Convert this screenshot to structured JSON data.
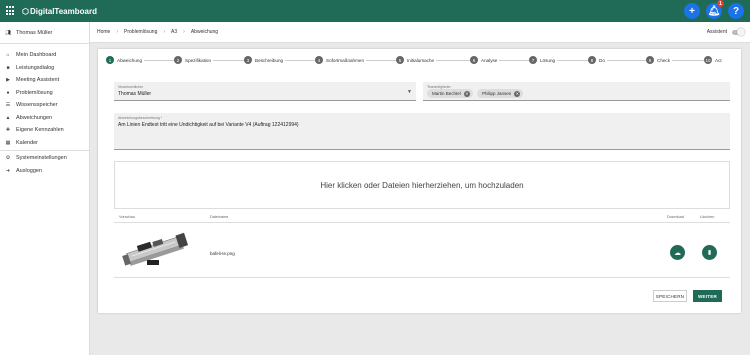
{
  "app": {
    "brand": "DigitalTeamboard",
    "notification_count": "1"
  },
  "header_buttons": {
    "add": "+",
    "help": "?"
  },
  "sidebar": {
    "user": "Thomas Müller",
    "items": [
      {
        "label": "Mein Dashboard",
        "icon": "home-icon"
      },
      {
        "label": "Leistungsdialog",
        "icon": "briefcase-icon"
      },
      {
        "label": "Meeting Assistent",
        "icon": "camera-icon"
      },
      {
        "label": "Problemlösung",
        "icon": "lightbulb-icon"
      },
      {
        "label": "Wissensspeicher",
        "icon": "list-icon"
      },
      {
        "label": "Abweichungen",
        "icon": "warning-icon"
      },
      {
        "label": "Eigene Kennzahlen",
        "icon": "user-plus-icon"
      },
      {
        "label": "Kalender",
        "icon": "calendar-icon"
      },
      {
        "label": "Systemeinstellungen",
        "icon": "users-cog-icon"
      },
      {
        "label": "Ausloggen",
        "icon": "logout-icon"
      }
    ]
  },
  "breadcrumb": [
    "Home",
    "Problemlösung",
    "A3",
    "Abweichung"
  ],
  "assistant_label": "Assistent",
  "steps": [
    {
      "num": "1",
      "label": "Abweichung"
    },
    {
      "num": "2",
      "label": "Spezifikation"
    },
    {
      "num": "3",
      "label": "Beschreibung"
    },
    {
      "num": "4",
      "label": "Sofortmaßnahmen"
    },
    {
      "num": "5",
      "label": "Initialursache"
    },
    {
      "num": "6",
      "label": "Analyse"
    },
    {
      "num": "7",
      "label": "Lösung"
    },
    {
      "num": "8",
      "label": "Do"
    },
    {
      "num": "9",
      "label": "Check"
    },
    {
      "num": "10",
      "label": "Act"
    }
  ],
  "form": {
    "responsible_label": "Verantwortlicher",
    "responsible_value": "Thomas Müller",
    "team_label": "Teammitglieder",
    "team_members": [
      "Martin Bechtel",
      "Philipp Jansen"
    ],
    "description_label": "Abweichungsbeschreibung *",
    "description_value": "Am Linien Endtest tritt eine Undichtigkeit auf bei Variante V4 (Auftrag 122412994)"
  },
  "upload": {
    "dropzone_text": "Hier klicken oder Dateien hierherziehen, um hochzuladen",
    "columns": {
      "preview": "Vorschau",
      "filename": "Dateiname",
      "download": "Download",
      "delete": "Löschen"
    },
    "files": [
      {
        "name": "bafeli-te.png"
      }
    ]
  },
  "actions": {
    "save": "SPEICHERN",
    "next": "WEITER"
  },
  "colors": {
    "brand": "#1f6b57",
    "accent_blue": "#1a73e8"
  }
}
